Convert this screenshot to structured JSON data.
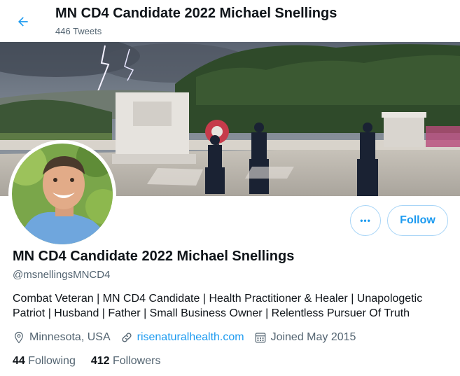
{
  "header": {
    "title": "MN CD4 Candidate 2022 Michael Snellings",
    "tweet_count": "446 Tweets",
    "back_icon": "arrow-left-icon"
  },
  "profile": {
    "name": "MN CD4 Candidate 2022 Michael Snellings",
    "handle": "@msnellingsMNCD4",
    "bio_line1": "Combat Veteran | MN CD4 Candidate | Health Practitioner & Healer | Unapologetic",
    "bio_line2": "Patriot | Husband | Father | Small Business Owner | Relentless Pursuer Of Truth",
    "location": "Minnesota, USA",
    "website": "risenaturalhealth.com",
    "joined": "Joined May 2015",
    "following_count": "44",
    "following_label": "Following",
    "followers_count": "412",
    "followers_label": "Followers"
  },
  "actions": {
    "more_label": "•••",
    "follow_label": "Follow"
  },
  "colors": {
    "accent": "#1d9bf0",
    "text": "#0f1419",
    "muted": "#536471"
  }
}
